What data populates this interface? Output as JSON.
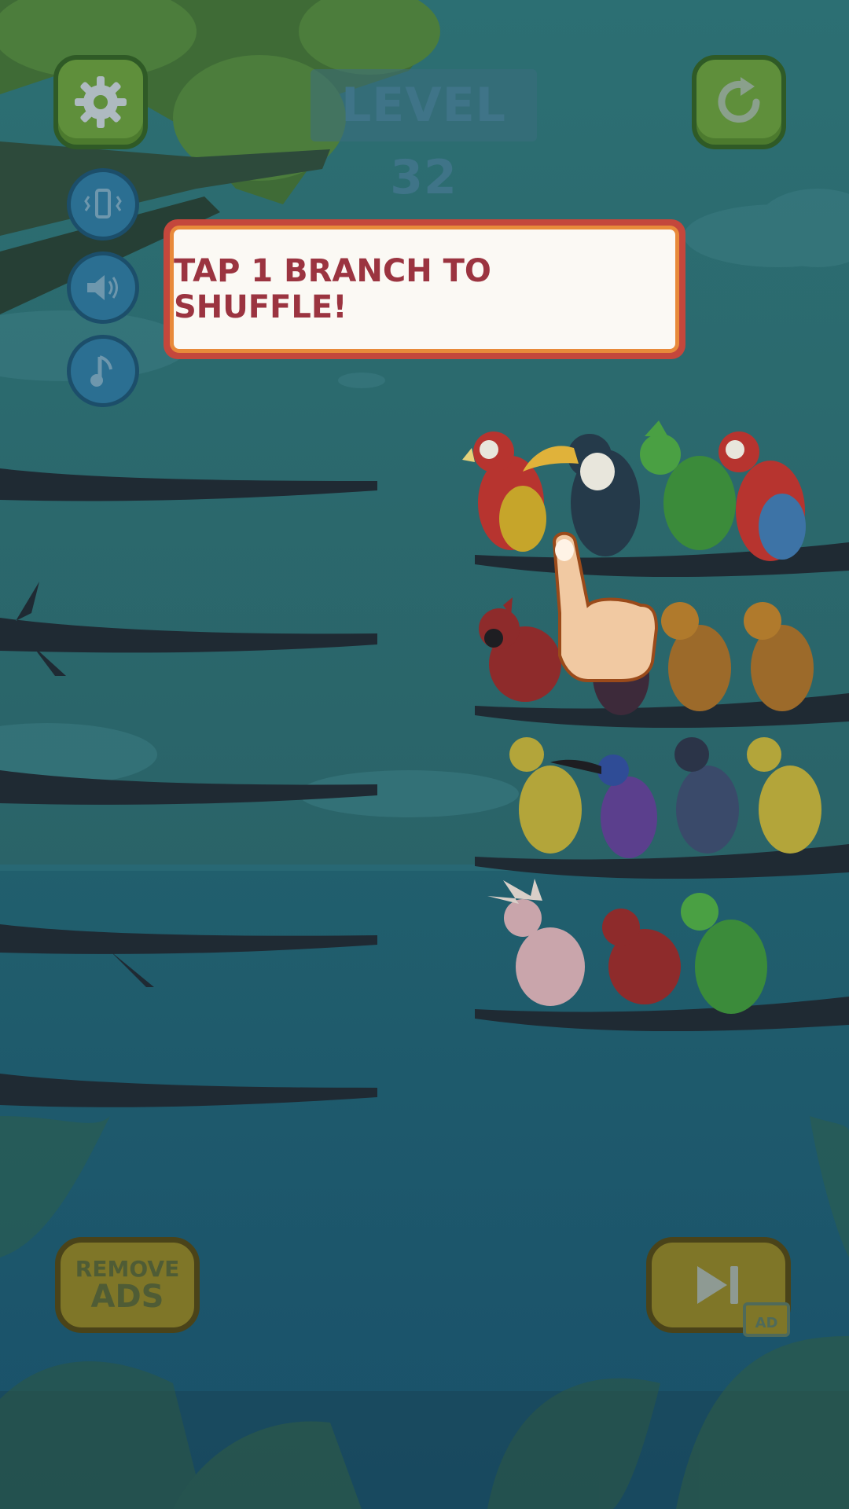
{
  "level": {
    "label": "LEVEL 32"
  },
  "tip": {
    "text": "TAP 1 BRANCH TO SHUFFLE!"
  },
  "buttons": {
    "settings_icon": "gear-icon",
    "restart_icon": "restart-icon",
    "vibration_icon": "vibration-icon",
    "sound_icon": "speaker-icon",
    "music_icon": "music-note-icon",
    "remove_ads_line1": "REMOVE",
    "remove_ads_line2": "ADS",
    "skip_icon": "skip-icon",
    "ad_badge": "AD"
  },
  "birds": {
    "branch_1": [
      "scarlet-macaw",
      "toucan",
      "green-turaco",
      "scarlet-macaw"
    ],
    "branch_2": [
      "cardinal",
      "dark-bird",
      "brown-crested-bird",
      "brown-crested-bird"
    ],
    "branch_3": [
      "yellow-bird",
      "purple-sunbird",
      "blue-jay",
      "yellow-bird"
    ],
    "branch_4": [
      "pink-cockatoo",
      "cardinal",
      "green-turaco"
    ]
  },
  "colors": {
    "sky": "#2a6a72",
    "water": "#1f5f6e",
    "branch": "#1f2a33",
    "tip_border": "#c4473c",
    "tip_text": "#9b3440"
  }
}
